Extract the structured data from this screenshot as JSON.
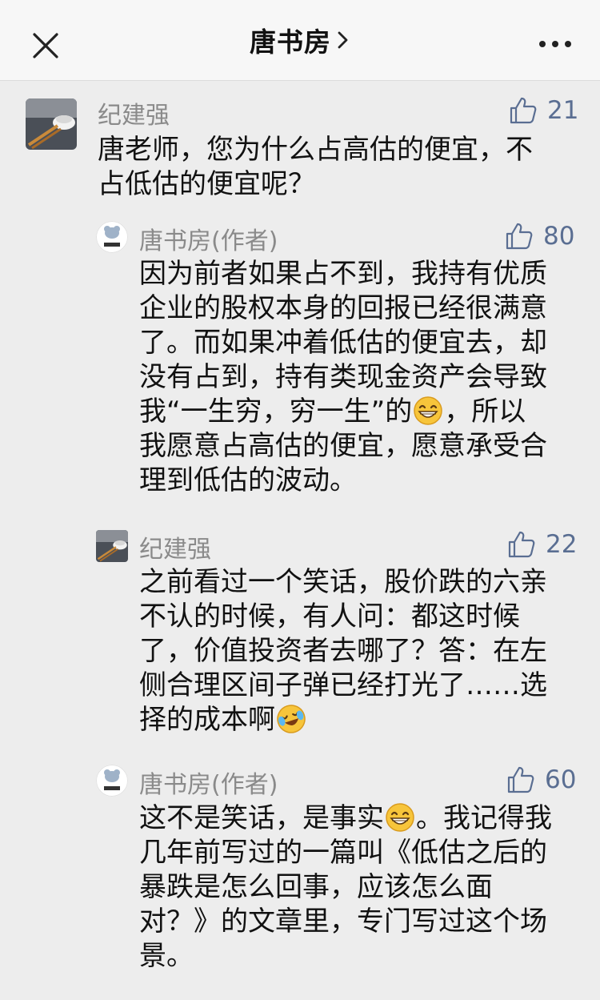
{
  "header": {
    "title": "唐书房"
  },
  "comments": [
    {
      "author": "纪建强",
      "likes": "21",
      "lines": [
        "唐老师，您为什么占高估的便宜，不",
        "占低估的便宜呢？"
      ]
    },
    {
      "author": "唐书房(作者)",
      "likes": "80",
      "avatar_text": "唐书房",
      "lines": [
        "因为前者如果占不到，我持有优质",
        "企业的股权本身的回报已经很满意",
        "了。而如果冲着低估的便宜去，却",
        "没有占到，持有类现金资产会导致"
      ],
      "line5_a": "我“一生穷，穷一生”的",
      "line5_b": "，所以",
      "lines_after": [
        "我愿意占高估的便宜，愿意承受合",
        "理到低估的波动。"
      ]
    },
    {
      "author": "纪建强",
      "likes": "22",
      "lines": [
        "之前看过一个笑话，股价跌的六亲",
        "不认的时候，有人问：都这时候",
        "了，价值投资者去哪了？答：在左",
        "侧合理区间子弹已经打光了……选"
      ],
      "last_line": "择的成本啊"
    },
    {
      "author": "唐书房(作者)",
      "likes": "60",
      "avatar_text": "唐书房",
      "first_a": "这不是笑话，是事实",
      "first_b": "。我记得我",
      "lines": [
        "几年前写过的一篇叫《低估之后的",
        "暴跌是怎么回事，应该怎么面",
        "对？》的文章里，专门写过这个场",
        "景。"
      ]
    }
  ],
  "icons": [
    "close-icon",
    "chevron-right-icon",
    "more-icon",
    "thumbs-up-icon",
    "grin-emoji",
    "laugh-cry-emoji"
  ],
  "colors": {
    "background": "#ededed",
    "name": "#8a8a8a",
    "likes": "#5a6e92"
  }
}
